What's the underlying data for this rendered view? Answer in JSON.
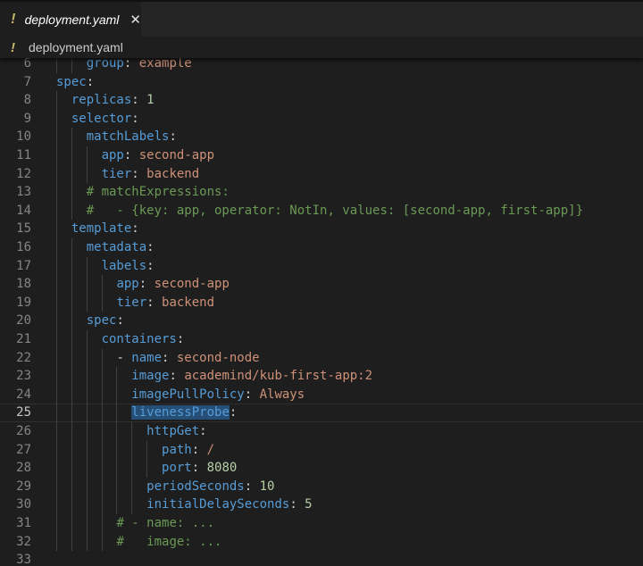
{
  "tab": {
    "icon": "!",
    "label": "deployment.yaml",
    "close": "✕"
  },
  "breadcrumb": {
    "icon": "!",
    "label": "deployment.yaml"
  },
  "code": {
    "active_line": 25,
    "lines": [
      {
        "n": "6",
        "indent": 2,
        "seg": [
          {
            "t": "group",
            "c": "k"
          },
          {
            "t": ": ",
            "c": "p"
          },
          {
            "t": "example",
            "c": "s"
          }
        ]
      },
      {
        "n": "7",
        "indent": 0,
        "seg": [
          {
            "t": "spec",
            "c": "k"
          },
          {
            "t": ":",
            "c": "p"
          }
        ]
      },
      {
        "n": "8",
        "indent": 1,
        "seg": [
          {
            "t": "replicas",
            "c": "k"
          },
          {
            "t": ": ",
            "c": "p"
          },
          {
            "t": "1",
            "c": "n"
          }
        ]
      },
      {
        "n": "9",
        "indent": 1,
        "seg": [
          {
            "t": "selector",
            "c": "k"
          },
          {
            "t": ":",
            "c": "p"
          }
        ]
      },
      {
        "n": "10",
        "indent": 2,
        "seg": [
          {
            "t": "matchLabels",
            "c": "k"
          },
          {
            "t": ":",
            "c": "p"
          }
        ]
      },
      {
        "n": "11",
        "indent": 3,
        "seg": [
          {
            "t": "app",
            "c": "k"
          },
          {
            "t": ": ",
            "c": "p"
          },
          {
            "t": "second-app",
            "c": "s"
          }
        ]
      },
      {
        "n": "12",
        "indent": 3,
        "seg": [
          {
            "t": "tier",
            "c": "k"
          },
          {
            "t": ": ",
            "c": "p"
          },
          {
            "t": "backend",
            "c": "s"
          }
        ]
      },
      {
        "n": "13",
        "indent": 2,
        "seg": [
          {
            "t": "# matchExpressions:",
            "c": "c"
          }
        ]
      },
      {
        "n": "14",
        "indent": 2,
        "seg": [
          {
            "t": "#   - {key: app, operator: NotIn, values: [second-app, first-app]}",
            "c": "c"
          }
        ]
      },
      {
        "n": "15",
        "indent": 1,
        "seg": [
          {
            "t": "template",
            "c": "k"
          },
          {
            "t": ":",
            "c": "p"
          }
        ]
      },
      {
        "n": "16",
        "indent": 2,
        "seg": [
          {
            "t": "metadata",
            "c": "k"
          },
          {
            "t": ":",
            "c": "p"
          }
        ]
      },
      {
        "n": "17",
        "indent": 3,
        "seg": [
          {
            "t": "labels",
            "c": "k"
          },
          {
            "t": ":",
            "c": "p"
          }
        ]
      },
      {
        "n": "18",
        "indent": 4,
        "seg": [
          {
            "t": "app",
            "c": "k"
          },
          {
            "t": ": ",
            "c": "p"
          },
          {
            "t": "second-app",
            "c": "s"
          }
        ]
      },
      {
        "n": "19",
        "indent": 4,
        "seg": [
          {
            "t": "tier",
            "c": "k"
          },
          {
            "t": ": ",
            "c": "p"
          },
          {
            "t": "backend",
            "c": "s"
          }
        ]
      },
      {
        "n": "20",
        "indent": 2,
        "seg": [
          {
            "t": "spec",
            "c": "k"
          },
          {
            "t": ":",
            "c": "p"
          }
        ]
      },
      {
        "n": "21",
        "indent": 3,
        "seg": [
          {
            "t": "containers",
            "c": "k"
          },
          {
            "t": ":",
            "c": "p"
          }
        ]
      },
      {
        "n": "22",
        "indent": 4,
        "seg": [
          {
            "t": "- ",
            "c": "p"
          },
          {
            "t": "name",
            "c": "k"
          },
          {
            "t": ": ",
            "c": "p"
          },
          {
            "t": "second-node",
            "c": "s"
          }
        ]
      },
      {
        "n": "23",
        "indent": 5,
        "seg": [
          {
            "t": "image",
            "c": "k"
          },
          {
            "t": ": ",
            "c": "p"
          },
          {
            "t": "academind/kub-first-app:2",
            "c": "s"
          }
        ]
      },
      {
        "n": "24",
        "indent": 5,
        "seg": [
          {
            "t": "imagePullPolicy",
            "c": "k"
          },
          {
            "t": ": ",
            "c": "p"
          },
          {
            "t": "Always",
            "c": "s"
          }
        ]
      },
      {
        "n": "25",
        "indent": 5,
        "seg": [
          {
            "t": "livenessProbe",
            "c": "hl"
          },
          {
            "t": ":",
            "c": "p"
          }
        ]
      },
      {
        "n": "26",
        "indent": 6,
        "seg": [
          {
            "t": "httpGet",
            "c": "k"
          },
          {
            "t": ":",
            "c": "p"
          }
        ]
      },
      {
        "n": "27",
        "indent": 7,
        "seg": [
          {
            "t": "path",
            "c": "k"
          },
          {
            "t": ": ",
            "c": "p"
          },
          {
            "t": "/",
            "c": "s"
          }
        ]
      },
      {
        "n": "28",
        "indent": 7,
        "seg": [
          {
            "t": "port",
            "c": "k"
          },
          {
            "t": ": ",
            "c": "p"
          },
          {
            "t": "8080",
            "c": "n"
          }
        ]
      },
      {
        "n": "29",
        "indent": 6,
        "seg": [
          {
            "t": "periodSeconds",
            "c": "k"
          },
          {
            "t": ": ",
            "c": "p"
          },
          {
            "t": "10",
            "c": "n"
          }
        ]
      },
      {
        "n": "30",
        "indent": 6,
        "seg": [
          {
            "t": "initialDelaySeconds",
            "c": "k"
          },
          {
            "t": ": ",
            "c": "p"
          },
          {
            "t": "5",
            "c": "n"
          }
        ]
      },
      {
        "n": "31",
        "indent": 4,
        "seg": [
          {
            "t": "# - name: ...",
            "c": "c"
          }
        ]
      },
      {
        "n": "32",
        "indent": 4,
        "seg": [
          {
            "t": "#   image: ...",
            "c": "c"
          }
        ]
      },
      {
        "n": "33",
        "indent": 0,
        "seg": []
      }
    ]
  }
}
